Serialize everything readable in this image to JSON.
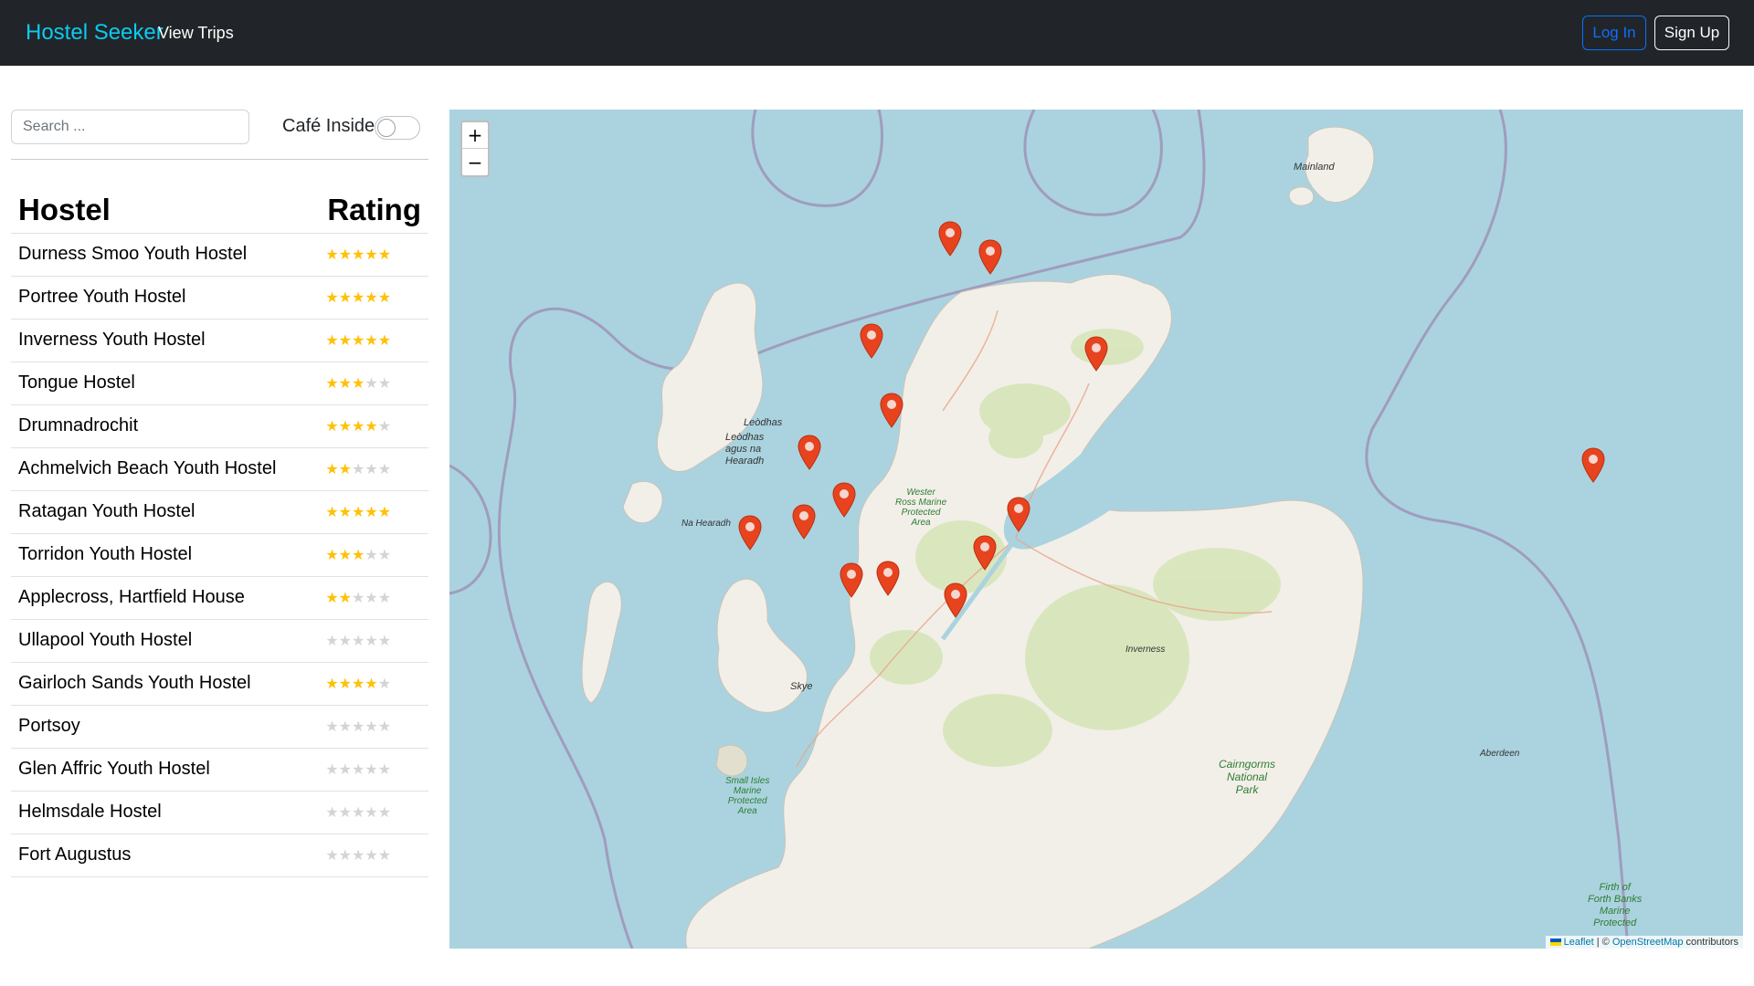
{
  "navbar": {
    "brand": "Hostel Seeker",
    "view_trips": "View Trips",
    "login": "Log In",
    "signup": "Sign Up"
  },
  "sidebar": {
    "search_placeholder": "Search ...",
    "cafe_toggle_label": "Café Inside",
    "cafe_toggle_on": false,
    "table_headers": {
      "hostel": "Hostel",
      "rating": "Rating"
    },
    "hostels": [
      {
        "name": "Durness Smoo Youth Hostel",
        "rating": 5
      },
      {
        "name": "Portree Youth Hostel",
        "rating": 5
      },
      {
        "name": "Inverness Youth Hostel",
        "rating": 5
      },
      {
        "name": "Tongue Hostel",
        "rating": 3
      },
      {
        "name": "Drumnadrochit",
        "rating": 4
      },
      {
        "name": "Achmelvich Beach Youth Hostel",
        "rating": 2
      },
      {
        "name": "Ratagan Youth Hostel",
        "rating": 5
      },
      {
        "name": "Torridon Youth Hostel",
        "rating": 3
      },
      {
        "name": "Applecross, Hartfield House",
        "rating": 2
      },
      {
        "name": "Ullapool Youth Hostel",
        "rating": 0
      },
      {
        "name": "Gairloch Sands Youth Hostel",
        "rating": 4
      },
      {
        "name": "Portsoy",
        "rating": 0
      },
      {
        "name": "Glen Affric Youth Hostel",
        "rating": 0
      },
      {
        "name": "Helmsdale Hostel",
        "rating": 0
      },
      {
        "name": "Fort Augustus",
        "rating": 0
      }
    ]
  },
  "map": {
    "zoom_in": "+",
    "zoom_out": "−",
    "marker_color": "#e8431f",
    "water_color": "#aad3df",
    "land_color": "#f2efe9",
    "labels": {
      "mainland": "Mainland",
      "leodhas": "Leòdhas",
      "leodhas_harris_1": "Leòdhas",
      "leodhas_harris_2": "agus na",
      "leodhas_harris_3": "Hearadh",
      "na_hearadh": "Na Hearadh",
      "skye": "Skye",
      "inverness": "Inverness",
      "aberdeen": "Aberdeen",
      "wester_ross_1": "Wester",
      "wester_ross_2": "Ross Marine",
      "wester_ross_3": "Protected",
      "wester_ross_4": "Area",
      "small_isles_1": "Small Isles",
      "small_isles_2": "Marine",
      "small_isles_3": "Protected",
      "small_isles_4": "Area",
      "cairngorms_1": "Cairngorms",
      "cairngorms_2": "National",
      "cairngorms_3": "Park",
      "forth_1": "Firth of",
      "forth_2": "Forth Banks",
      "forth_3": "Marine",
      "forth_4": "Protected"
    },
    "attribution": {
      "leaflet": "Leaflet",
      "sep": " | © ",
      "osm": "OpenStreetMap",
      "contributors": " contributors"
    }
  }
}
